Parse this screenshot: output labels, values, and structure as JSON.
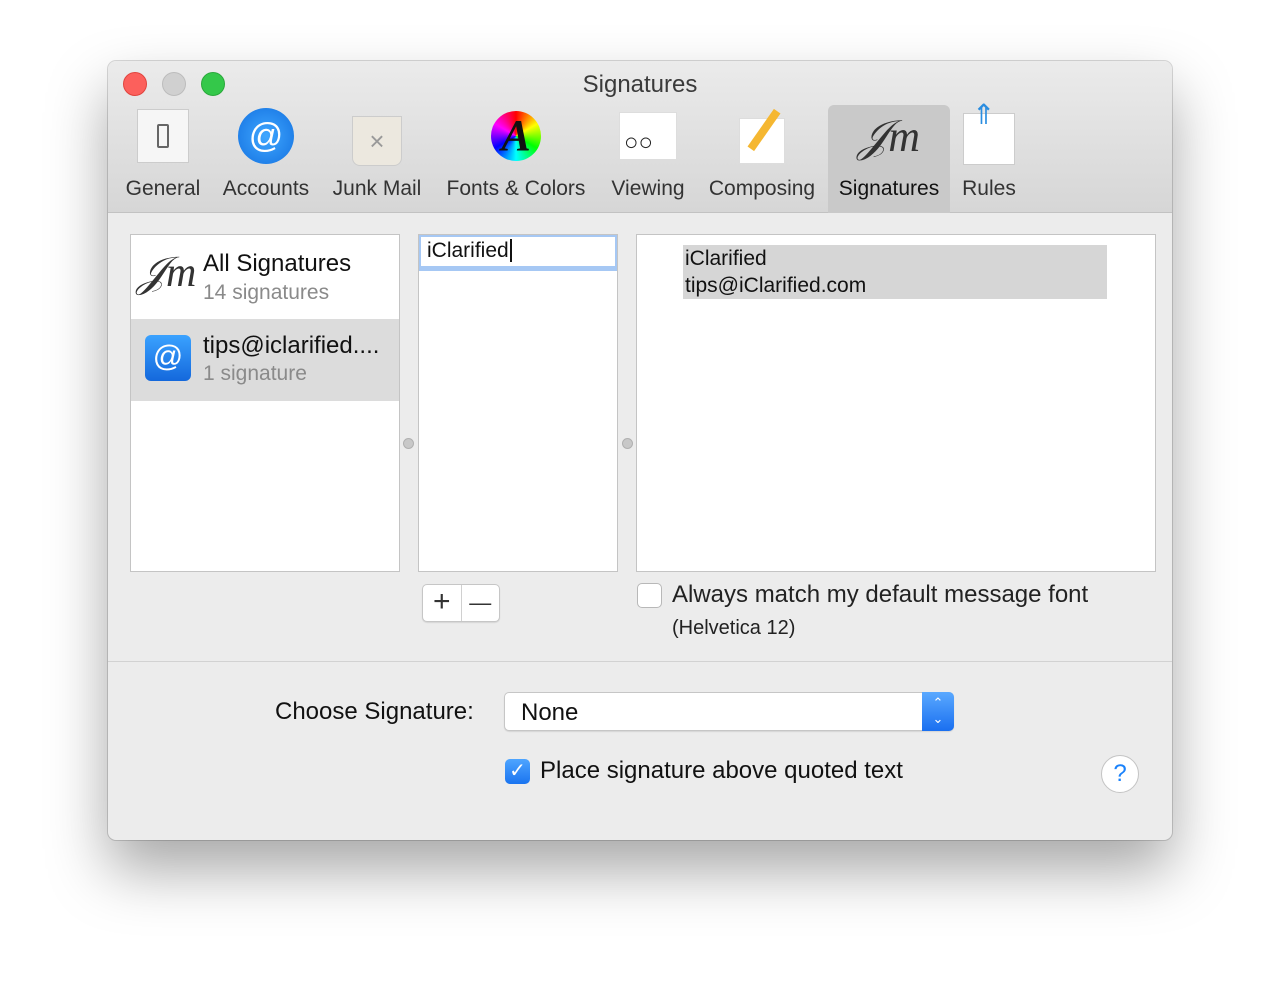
{
  "window": {
    "title": "Signatures"
  },
  "toolbar": [
    {
      "label": "General",
      "icon": "switch-icon"
    },
    {
      "label": "Accounts",
      "icon": "at-icon"
    },
    {
      "label": "Junk Mail",
      "icon": "trash-icon"
    },
    {
      "label": "Fonts & Colors",
      "icon": "font-color-icon"
    },
    {
      "label": "Viewing",
      "icon": "glasses-icon"
    },
    {
      "label": "Composing",
      "icon": "pencil-icon"
    },
    {
      "label": "Signatures",
      "icon": "signature-icon",
      "selected": true
    },
    {
      "label": "Rules",
      "icon": "rules-icon"
    }
  ],
  "accounts": [
    {
      "title": "All Signatures",
      "subtitle": "14 signatures"
    },
    {
      "title": "tips@iclarified....",
      "subtitle": "1 signature",
      "selected": true
    }
  ],
  "signatures": {
    "editing_name": "iClarified"
  },
  "preview": {
    "line1": "iClarified",
    "line2": "tips@iClarified.com"
  },
  "add_label": "+",
  "remove_label": "—",
  "match_font": {
    "label": "Always match my default message font",
    "note": "(Helvetica 12)",
    "checked": false
  },
  "choose": {
    "label": "Choose Signature:",
    "value": "None"
  },
  "place_above": {
    "label": "Place signature above quoted text",
    "checked": true
  },
  "help_label": "?",
  "colors": {
    "accent": "#1a82fb"
  }
}
